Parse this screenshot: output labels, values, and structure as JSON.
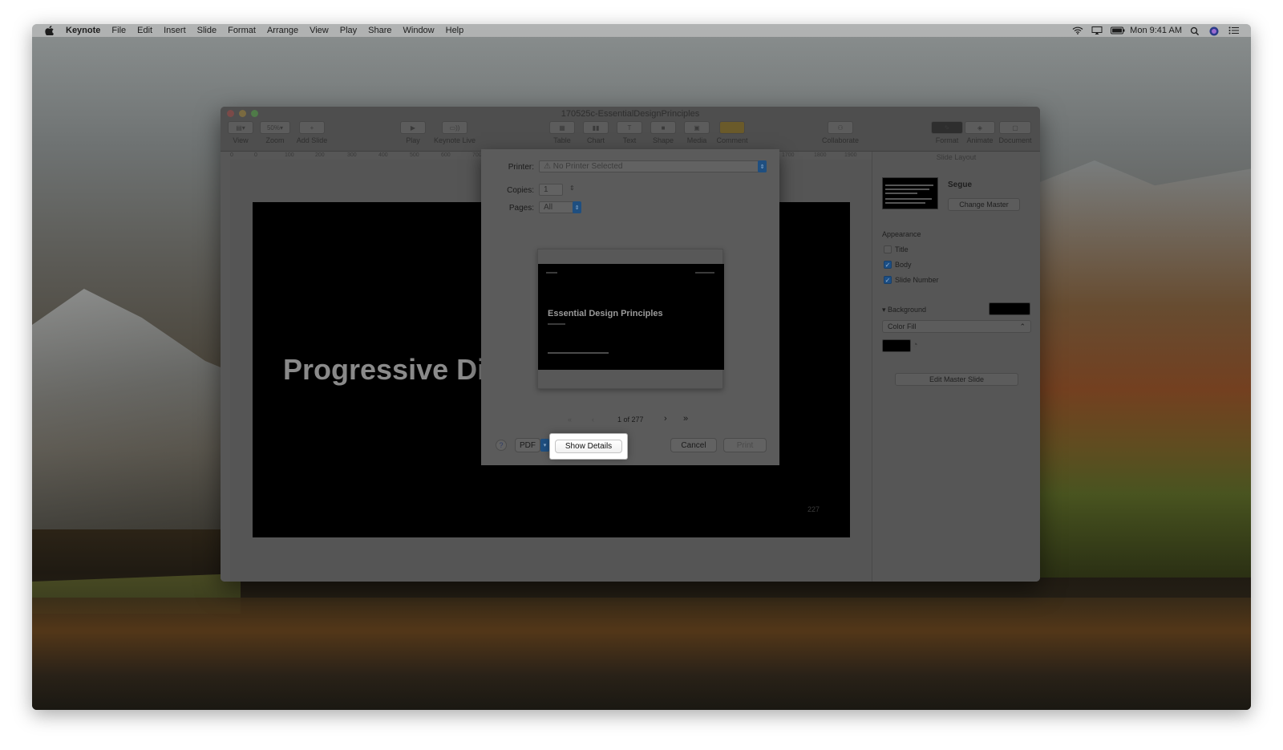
{
  "menubar": {
    "app_name": "Keynote",
    "items": [
      "File",
      "Edit",
      "Insert",
      "Slide",
      "Format",
      "Arrange",
      "View",
      "Play",
      "Share",
      "Window",
      "Help"
    ],
    "clock": "Mon 9:41 AM"
  },
  "window": {
    "title": "170525c-EssentialDesignPrinciples"
  },
  "toolbar": {
    "view": "View",
    "zoom": "Zoom",
    "zoom_value": "50%",
    "add_slide": "Add Slide",
    "play": "Play",
    "keynote_live": "Keynote Live",
    "table": "Table",
    "chart": "Chart",
    "text": "Text",
    "shape": "Shape",
    "media": "Media",
    "comment": "Comment",
    "collaborate": "Collaborate",
    "format": "Format",
    "animate": "Animate",
    "document": "Document"
  },
  "ruler": {
    "ticks": [
      "0",
      "0",
      "100",
      "200",
      "300",
      "400",
      "500",
      "600",
      "700"
    ],
    "ticks_right": [
      "1700",
      "1800",
      "1900"
    ]
  },
  "slide": {
    "title": "Progressive Dis",
    "number": "227"
  },
  "inspector": {
    "header": "Slide Layout",
    "layout_name": "Segue",
    "change_master": "Change Master",
    "appearance_label": "Appearance",
    "title_option": "Title",
    "body_option": "Body",
    "slide_number_option": "Slide Number",
    "title_checked": false,
    "body_checked": true,
    "slide_number_checked": true,
    "background_label": "Background",
    "fill_type": "Color Fill",
    "edit_master": "Edit Master Slide",
    "background_color": "#000000"
  },
  "print_dialog": {
    "printer_label": "Printer:",
    "printer_value": "⚠ No Printer Selected",
    "copies_label": "Copies:",
    "copies_value": "1",
    "pages_label": "Pages:",
    "pages_value": "All",
    "preview_title": "Essential Design Principles",
    "page_indicator": "1 of 277",
    "first_page": "«",
    "prev_page": "‹",
    "next_page": "›",
    "last_page": "»",
    "help": "?",
    "pdf": "PDF",
    "show_details": "Show Details",
    "cancel": "Cancel",
    "print": "Print"
  },
  "colors": {
    "accent_blue": "#1f4f80",
    "highlight": "#ffffff"
  }
}
